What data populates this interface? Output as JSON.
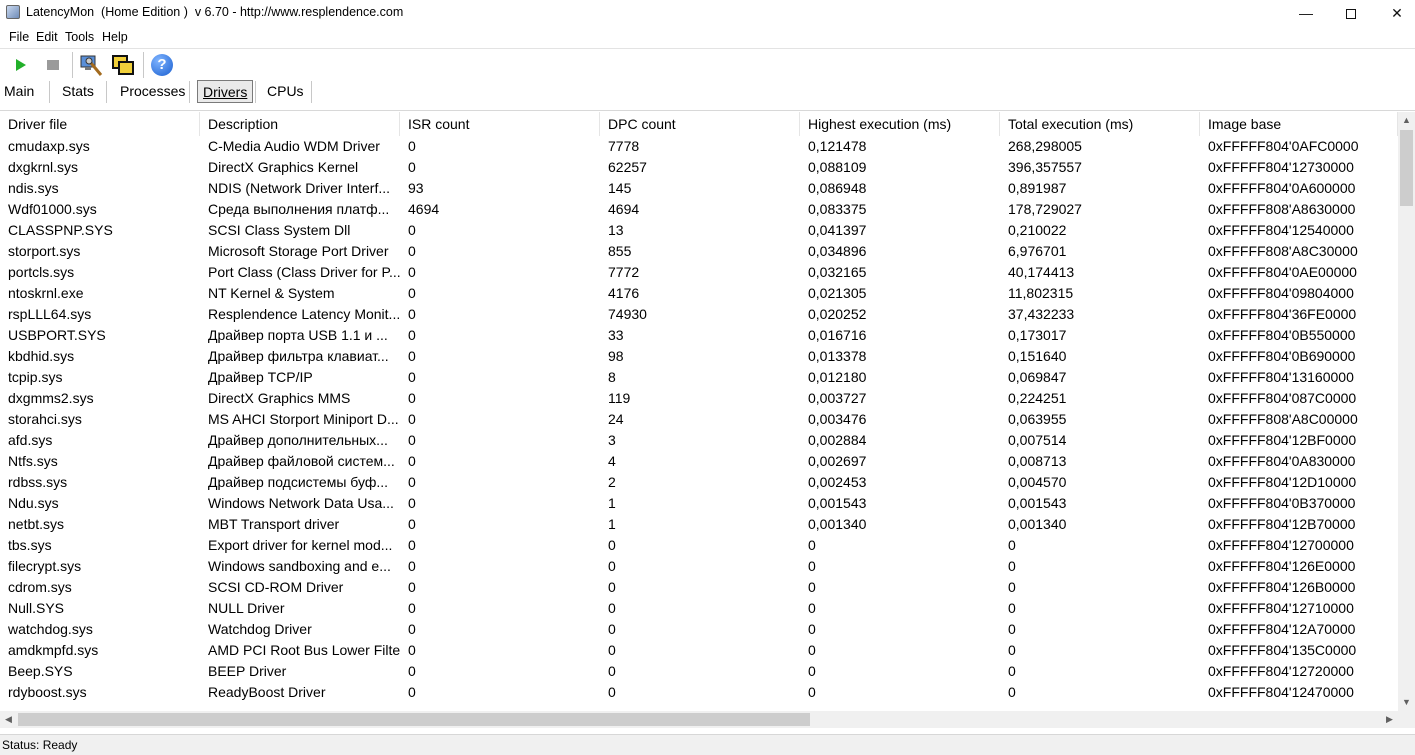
{
  "window": {
    "title": "LatencyMon  (Home Edition )  v 6.70 - http://www.resplendence.com",
    "minimize_glyph": "—",
    "close_glyph": "✕"
  },
  "menu": {
    "file": "File",
    "edit": "Edit",
    "tools": "Tools",
    "help": "Help"
  },
  "toolbar": {
    "icons": [
      "play-icon",
      "stop-icon",
      "monitor-icon",
      "windows-icon",
      "help-icon"
    ],
    "help_glyph": "?",
    "play_color": "#22b02a"
  },
  "tabs": {
    "main": "Main",
    "stats": "Stats",
    "processes": "Processes",
    "drivers": "Drivers",
    "cpus": "CPUs",
    "active": "Drivers"
  },
  "columns": [
    "Driver file",
    "Description",
    "ISR count",
    "DPC count",
    "Highest execution (ms)",
    "Total execution (ms)",
    "Image base"
  ],
  "rows": [
    [
      "cmudaxp.sys",
      "C-Media Audio WDM Driver",
      "0",
      "7778",
      "0,121478",
      "268,298005",
      "0xFFFFF804'0AFC0000"
    ],
    [
      "dxgkrnl.sys",
      "DirectX Graphics Kernel",
      "0",
      "62257",
      "0,088109",
      "396,357557",
      "0xFFFFF804'12730000"
    ],
    [
      "ndis.sys",
      "NDIS (Network Driver Interf...",
      "93",
      "145",
      "0,086948",
      "0,891987",
      "0xFFFFF804'0A600000"
    ],
    [
      "Wdf01000.sys",
      "Среда выполнения платф...",
      "4694",
      "4694",
      "0,083375",
      "178,729027",
      "0xFFFFF808'A8630000"
    ],
    [
      "CLASSPNP.SYS",
      "SCSI Class System Dll",
      "0",
      "13",
      "0,041397",
      "0,210022",
      "0xFFFFF804'12540000"
    ],
    [
      "storport.sys",
      "Microsoft Storage Port Driver",
      "0",
      "855",
      "0,034896",
      "6,976701",
      "0xFFFFF808'A8C30000"
    ],
    [
      "portcls.sys",
      "Port Class (Class Driver for P...",
      "0",
      "7772",
      "0,032165",
      "40,174413",
      "0xFFFFF804'0AE00000"
    ],
    [
      "ntoskrnl.exe",
      "NT Kernel & System",
      "0",
      "4176",
      "0,021305",
      "11,802315",
      "0xFFFFF804'09804000"
    ],
    [
      "rspLLL64.sys",
      "Resplendence Latency Monit...",
      "0",
      "74930",
      "0,020252",
      "37,432233",
      "0xFFFFF804'36FE0000"
    ],
    [
      "USBPORT.SYS",
      "Драйвер порта USB 1.1 и ...",
      "0",
      "33",
      "0,016716",
      "0,173017",
      "0xFFFFF804'0B550000"
    ],
    [
      "kbdhid.sys",
      "Драйвер фильтра клавиат...",
      "0",
      "98",
      "0,013378",
      "0,151640",
      "0xFFFFF804'0B690000"
    ],
    [
      "tcpip.sys",
      "Драйвер TCP/IP",
      "0",
      "8",
      "0,012180",
      "0,069847",
      "0xFFFFF804'13160000"
    ],
    [
      "dxgmms2.sys",
      "DirectX Graphics MMS",
      "0",
      "119",
      "0,003727",
      "0,224251",
      "0xFFFFF804'087C0000"
    ],
    [
      "storahci.sys",
      "MS AHCI Storport Miniport D...",
      "0",
      "24",
      "0,003476",
      "0,063955",
      "0xFFFFF808'A8C00000"
    ],
    [
      "afd.sys",
      "Драйвер дополнительных...",
      "0",
      "3",
      "0,002884",
      "0,007514",
      "0xFFFFF804'12BF0000"
    ],
    [
      "Ntfs.sys",
      "Драйвер файловой систем...",
      "0",
      "4",
      "0,002697",
      "0,008713",
      "0xFFFFF804'0A830000"
    ],
    [
      "rdbss.sys",
      "Драйвер подсистемы буф...",
      "0",
      "2",
      "0,002453",
      "0,004570",
      "0xFFFFF804'12D10000"
    ],
    [
      "Ndu.sys",
      "Windows Network Data Usa...",
      "0",
      "1",
      "0,001543",
      "0,001543",
      "0xFFFFF804'0B370000"
    ],
    [
      "netbt.sys",
      "MBT Transport driver",
      "0",
      "1",
      "0,001340",
      "0,001340",
      "0xFFFFF804'12B70000"
    ],
    [
      "tbs.sys",
      "Export driver for kernel mod...",
      "0",
      "0",
      "0",
      "0",
      "0xFFFFF804'12700000"
    ],
    [
      "filecrypt.sys",
      "Windows sandboxing and e...",
      "0",
      "0",
      "0",
      "0",
      "0xFFFFF804'126E0000"
    ],
    [
      "cdrom.sys",
      "SCSI CD-ROM Driver",
      "0",
      "0",
      "0",
      "0",
      "0xFFFFF804'126B0000"
    ],
    [
      "Null.SYS",
      "NULL Driver",
      "0",
      "0",
      "0",
      "0",
      "0xFFFFF804'12710000"
    ],
    [
      "watchdog.sys",
      "Watchdog Driver",
      "0",
      "0",
      "0",
      "0",
      "0xFFFFF804'12A70000"
    ],
    [
      "amdkmpfd.sys",
      "AMD PCI Root Bus Lower Filter",
      "0",
      "0",
      "0",
      "0",
      "0xFFFFF804'135C0000"
    ],
    [
      "Beep.SYS",
      "BEEP Driver",
      "0",
      "0",
      "0",
      "0",
      "0xFFFFF804'12720000"
    ],
    [
      "rdyboost.sys",
      "ReadyBoost Driver",
      "0",
      "0",
      "0",
      "0",
      "0xFFFFF804'12470000"
    ]
  ],
  "scroll": {
    "up": "▲",
    "down": "▼",
    "left": "◀",
    "right": "▶"
  },
  "status": {
    "text": "Status: Ready"
  }
}
